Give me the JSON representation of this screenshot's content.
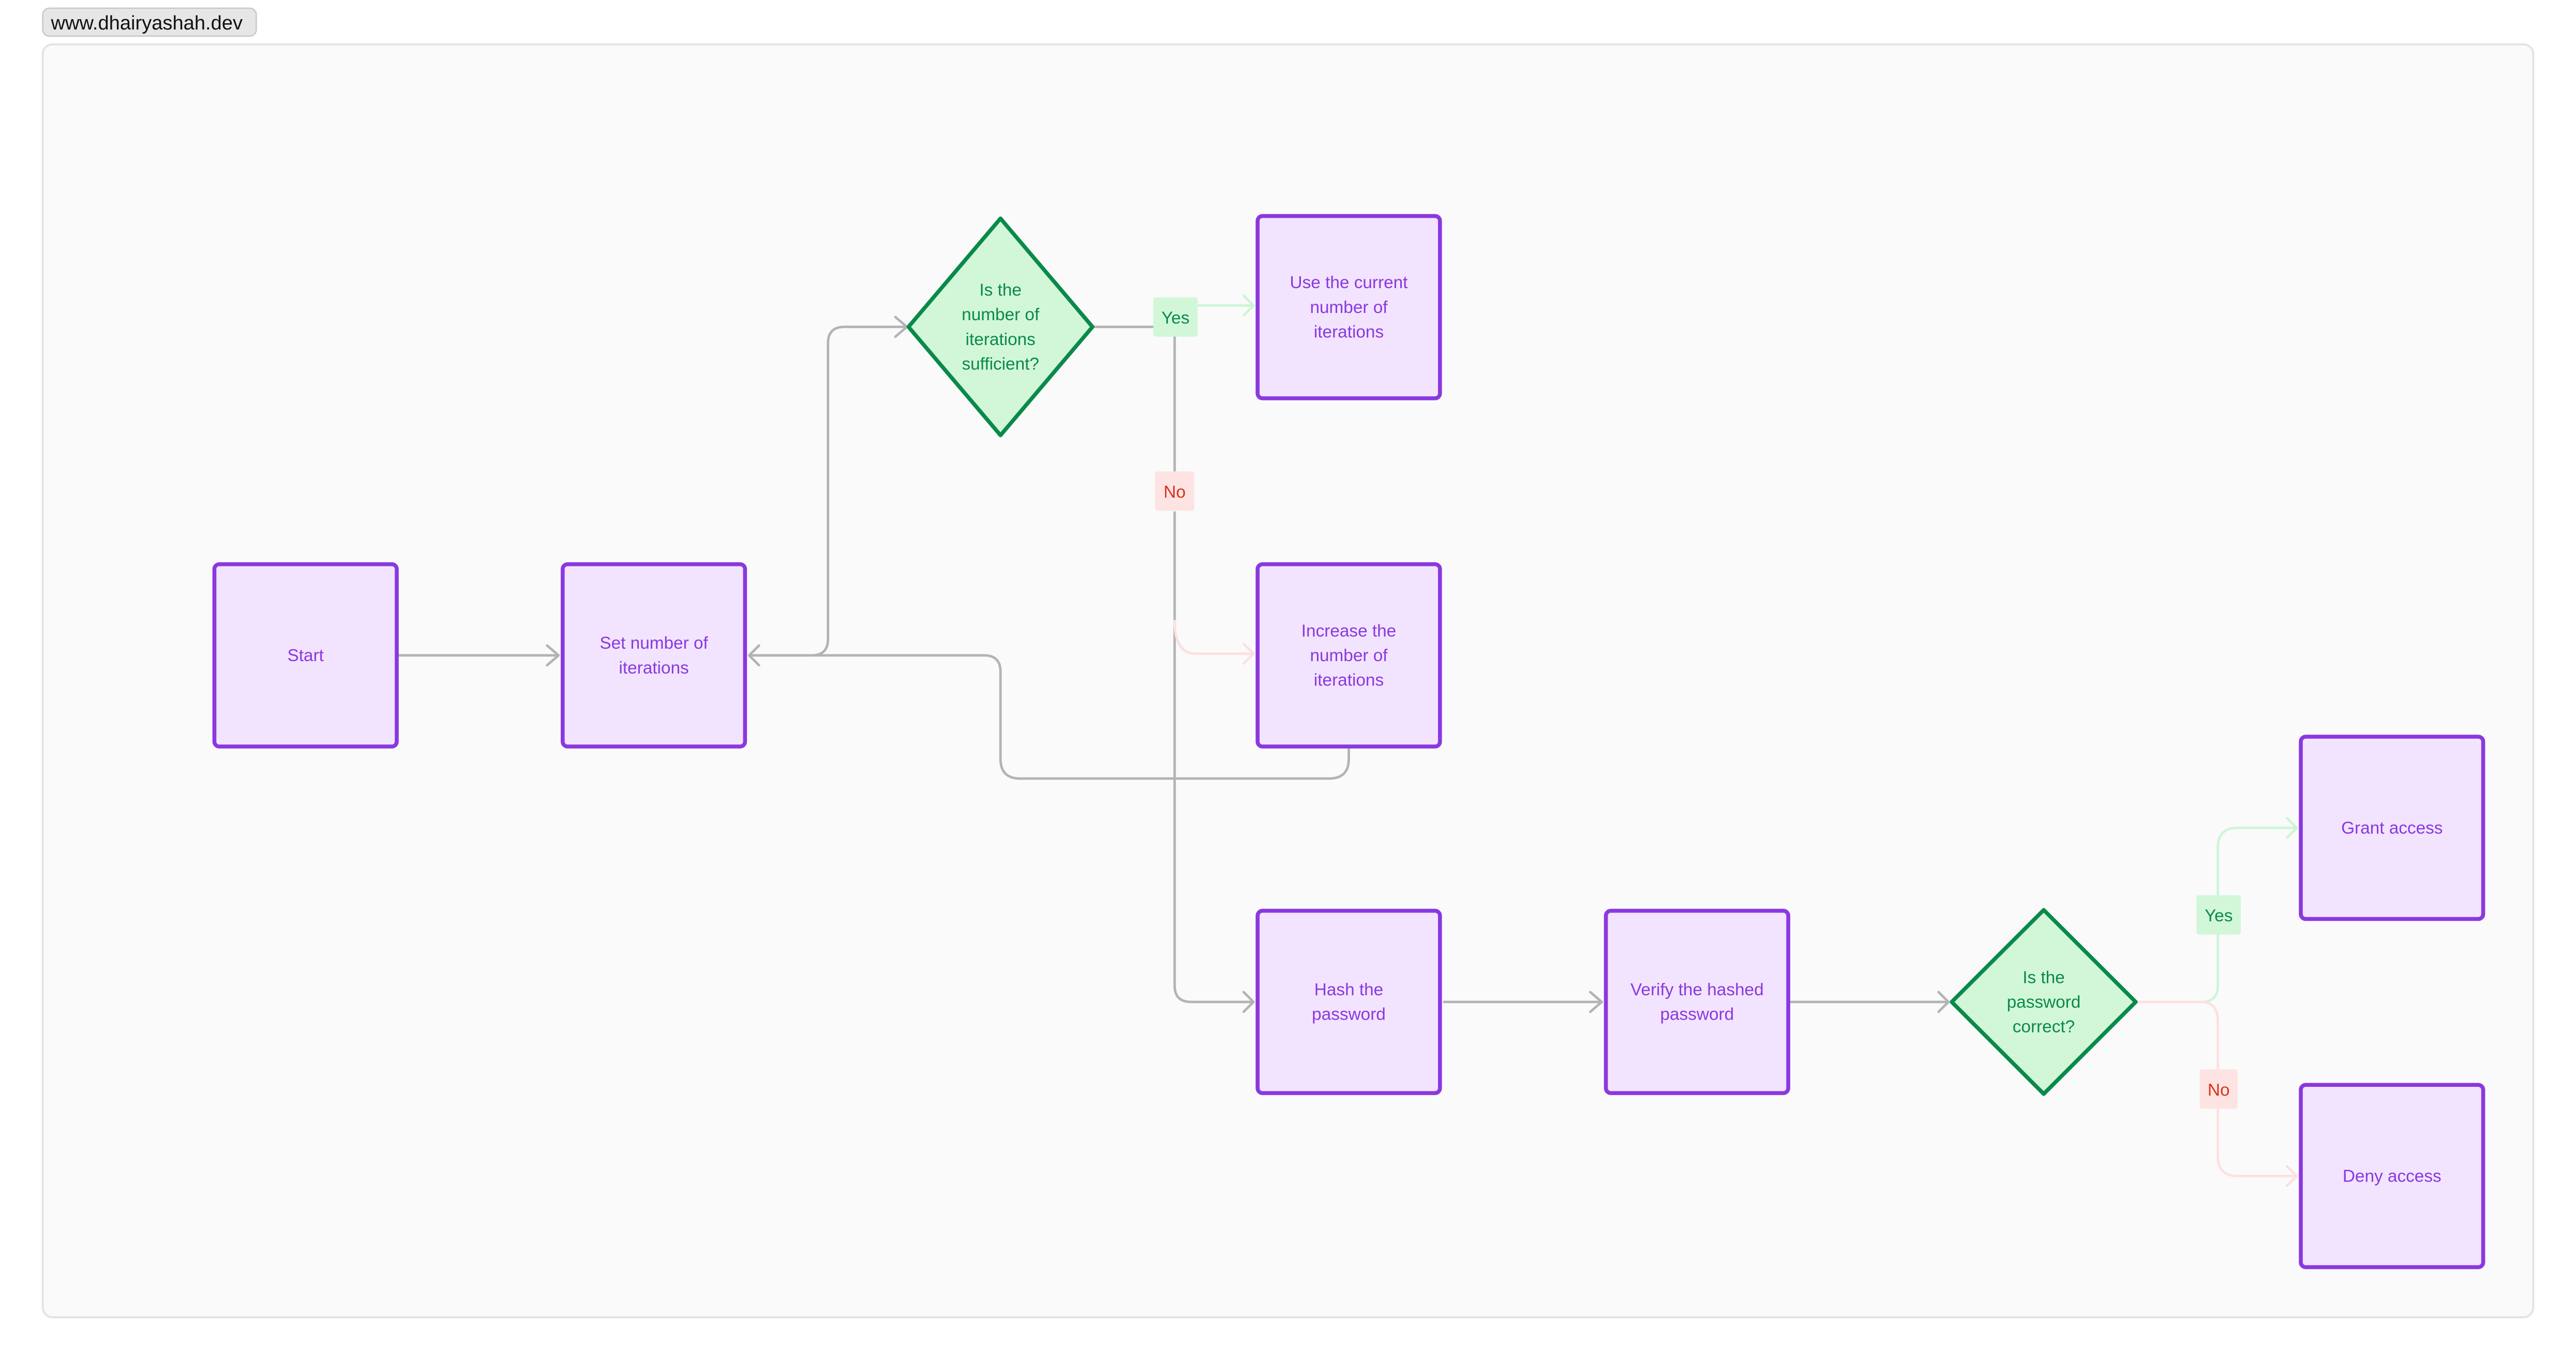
{
  "watermark": "www.dhairyashah.dev",
  "colors": {
    "process_fill": "#f2e4fe",
    "process_stroke": "#8a38e0",
    "decision_fill": "#d2f7d8",
    "decision_stroke": "#0a8a4a",
    "edge_default": "#b3b3b3",
    "edge_yes": "#cdf5d6",
    "edge_no": "#fde0e0",
    "canvas_bg": "#fafafa"
  },
  "nodes": [
    {
      "id": "start",
      "type": "process",
      "lines": [
        "Start"
      ]
    },
    {
      "id": "set-iterations",
      "type": "process",
      "lines": [
        "Set number of",
        "iterations"
      ]
    },
    {
      "id": "iterations-sufficient",
      "type": "decision",
      "lines": [
        "Is the",
        "number of",
        "iterations",
        "sufficient?"
      ]
    },
    {
      "id": "use-current",
      "type": "process",
      "lines": [
        "Use the current",
        "number of",
        "iterations"
      ]
    },
    {
      "id": "increase-iterations",
      "type": "process",
      "lines": [
        "Increase the",
        "number of",
        "iterations"
      ]
    },
    {
      "id": "hash-password",
      "type": "process",
      "lines": [
        "Hash the",
        "password"
      ]
    },
    {
      "id": "verify-hashed",
      "type": "process",
      "lines": [
        "Verify the hashed",
        "password"
      ]
    },
    {
      "id": "password-correct",
      "type": "decision",
      "lines": [
        "Is the",
        "password",
        "correct?"
      ]
    },
    {
      "id": "grant-access",
      "type": "process",
      "lines": [
        "Grant access"
      ]
    },
    {
      "id": "deny-access",
      "type": "process",
      "lines": [
        "Deny access"
      ]
    }
  ],
  "edges": [
    {
      "from": "start",
      "to": "set-iterations",
      "label": ""
    },
    {
      "from": "set-iterations",
      "to": "iterations-sufficient",
      "label": ""
    },
    {
      "from": "iterations-sufficient",
      "to": "use-current",
      "label": "Yes"
    },
    {
      "from": "iterations-sufficient",
      "to": "increase-iterations",
      "label": "No"
    },
    {
      "from": "increase-iterations",
      "to": "set-iterations",
      "label": ""
    },
    {
      "from": "iterations-sufficient",
      "to": "hash-password",
      "label": ""
    },
    {
      "from": "hash-password",
      "to": "verify-hashed",
      "label": ""
    },
    {
      "from": "verify-hashed",
      "to": "password-correct",
      "label": ""
    },
    {
      "from": "password-correct",
      "to": "grant-access",
      "label": "Yes"
    },
    {
      "from": "password-correct",
      "to": "deny-access",
      "label": "No"
    }
  ],
  "labels": {
    "yes": "Yes",
    "no": "No"
  }
}
